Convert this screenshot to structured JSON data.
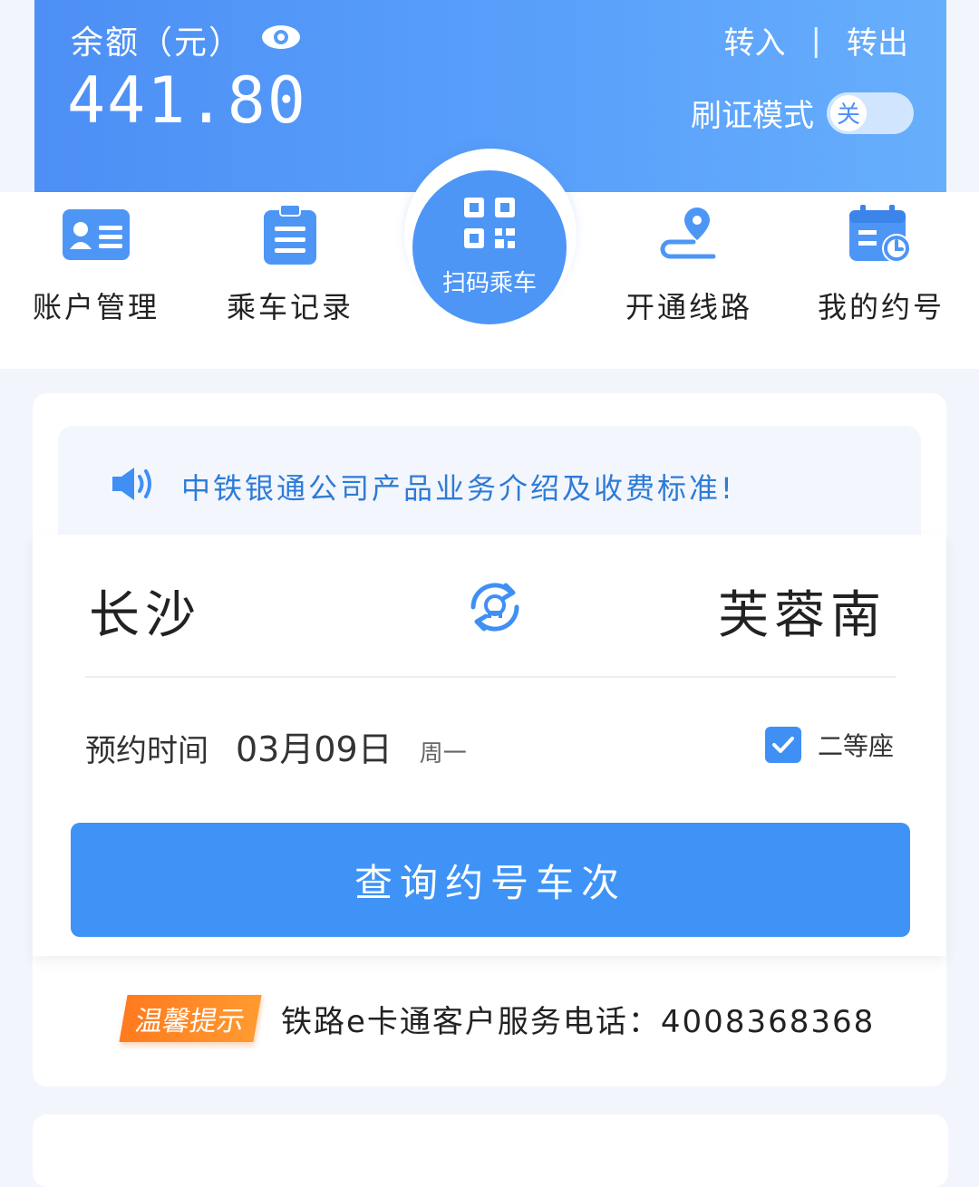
{
  "balance": {
    "label": "余额（元）",
    "value": "441.80"
  },
  "top_links": {
    "transfer_in": "转入",
    "separator": "|",
    "transfer_out": "转出"
  },
  "mode": {
    "label": "刷证模式",
    "toggle_text": "关"
  },
  "quick_actions": [
    {
      "label": "账户管理",
      "icon": "id-card-icon"
    },
    {
      "label": "乘车记录",
      "icon": "clipboard-icon"
    },
    {
      "label": "扫码乘车",
      "icon": "qr-code-icon"
    },
    {
      "label": "开通线路",
      "icon": "route-pin-icon"
    },
    {
      "label": "我的约号",
      "icon": "calendar-clock-icon"
    }
  ],
  "notice": {
    "text": "中铁银通公司产品业务介绍及收费标准!"
  },
  "route": {
    "from": "长沙",
    "to": "芙蓉南"
  },
  "reservation": {
    "label": "预约时间",
    "date": "03月09日",
    "weekday": "周一",
    "seat_label": "二等座"
  },
  "query_button": "查询约号车次",
  "tip": {
    "badge": "温馨提示",
    "text": "铁路e卡通客户服务电话：4008368368"
  },
  "colors": {
    "primary": "#4d96f6",
    "notice_text": "#2e7bd6",
    "tip_badge": "#ff7a1e"
  }
}
